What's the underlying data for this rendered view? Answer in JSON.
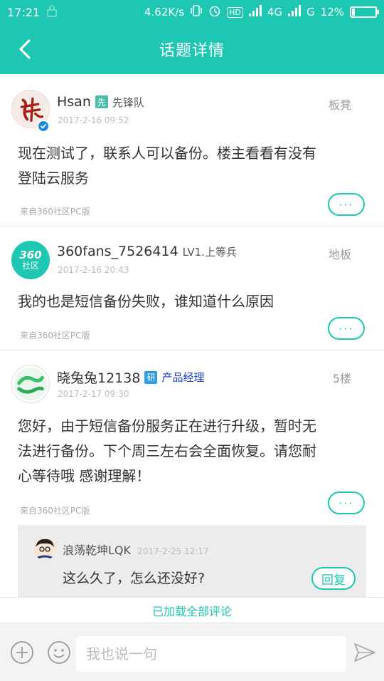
{
  "status_bar": {
    "time": "17:21",
    "network_speed": "4.62K/s",
    "hd": "HD",
    "net1": "4G",
    "net2": "G",
    "battery_percent": "12%",
    "battery_level": 0.12
  },
  "header": {
    "title": "话题详情"
  },
  "posts": [
    {
      "username": "Hsan",
      "badge": "先",
      "badge_color": "#4dbfa8",
      "role": "先锋队",
      "role_color": "#555555",
      "time": "2017-2-16 09:52",
      "floor": "板凳",
      "body": [
        "现在测试了，联系人可以备份。楼主看看有没有",
        "登陆云服务"
      ],
      "source": "来自360社区PC版",
      "more": "···"
    },
    {
      "username": "360fans_7526414",
      "level": "LV1.上等兵",
      "avatar_text_top": "360",
      "avatar_text_bottom": "社区",
      "time": "2017-2-16 20:43",
      "floor": "地板",
      "body": [
        "我的也是短信备份失败，谁知道什么原因"
      ],
      "source": "来自360社区PC版",
      "more": "···"
    },
    {
      "username": "晓兔兔12138",
      "badge": "研",
      "badge_color": "#2a9be8",
      "role": "产品经理",
      "role_color": "#1a3fd6",
      "time": "2017-2-17 09:30",
      "floor": "5楼",
      "body": [
        "您好，由于短信备份服务正在进行升级，暂时无",
        "法进行备份。下个周三左右会全面恢复。请您耐",
        "心等待哦 感谢理解！"
      ],
      "source": "来自360社区PC版",
      "more": "···",
      "reply": {
        "username": "浪荡乾坤LQK",
        "time": "2017-2-25 12:17",
        "text": "这么久了，怎么还没好?",
        "button": "回复"
      }
    }
  ],
  "loaded_all": "已加载全部评论",
  "composer": {
    "placeholder": "我也说一句"
  },
  "colors": {
    "accent": "#1dc7b2"
  }
}
